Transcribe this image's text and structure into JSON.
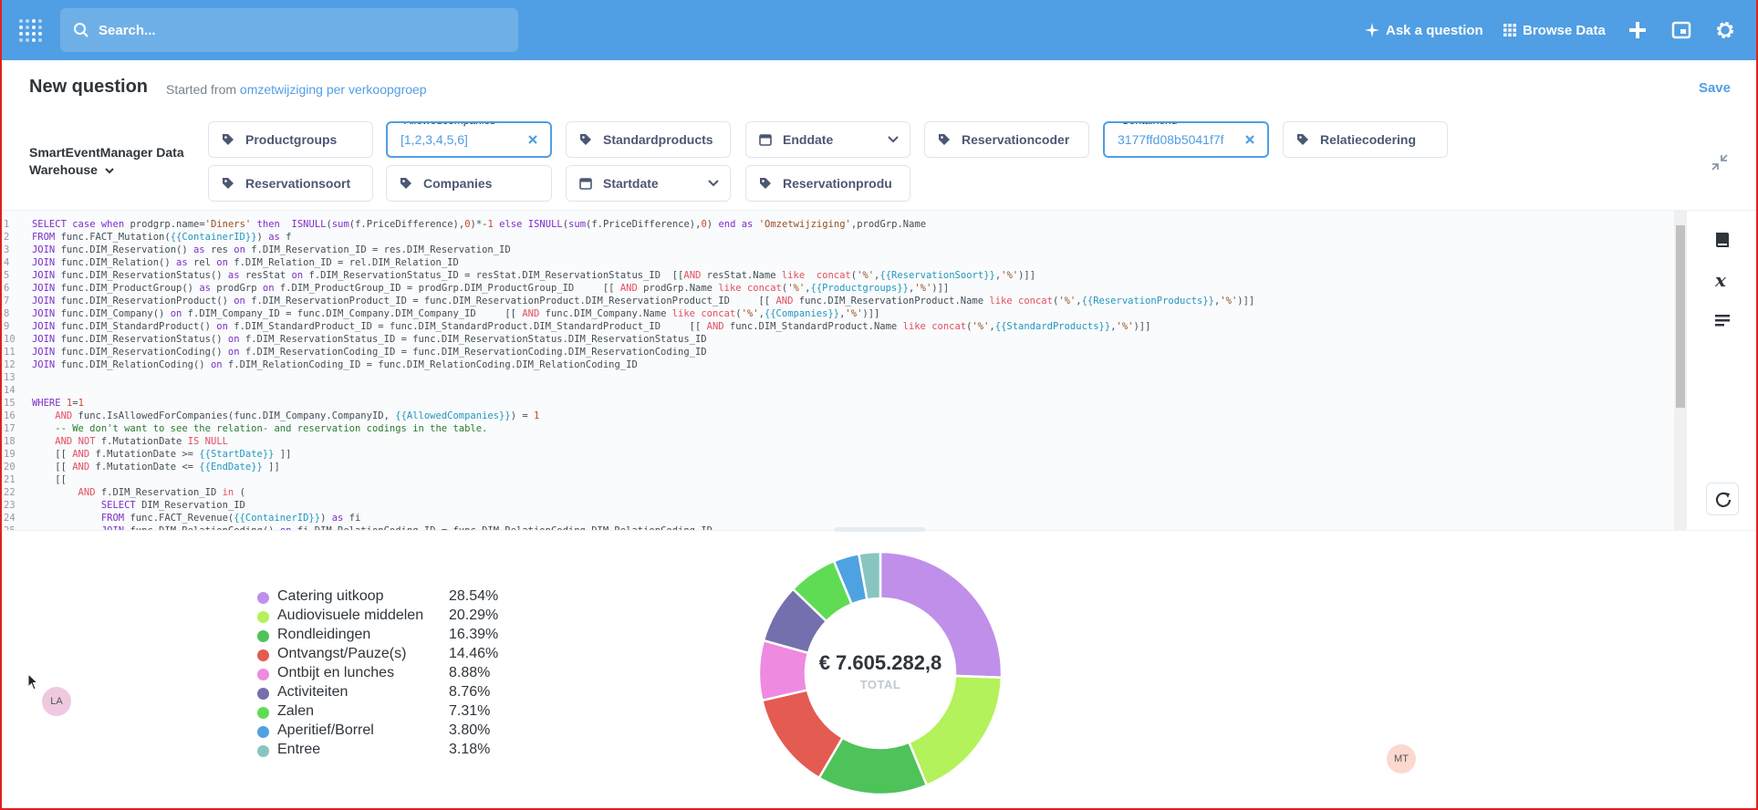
{
  "nav": {
    "search_placeholder": "Search...",
    "ask_label": "Ask a question",
    "browse_label": "Browse Data"
  },
  "header": {
    "title": "New question",
    "subtitle_prefix": "Started from",
    "subtitle_link": "omzetwijziging per verkoopgroep",
    "save_label": "Save"
  },
  "database": {
    "name": "SmartEventManager Data Warehouse"
  },
  "filters": [
    {
      "label": "Productgroups",
      "type": "tag"
    },
    {
      "label": "Allowedcompanies",
      "value": "[1,2,3,4,5,6]",
      "type": "tag",
      "active": true
    },
    {
      "label": "Standardproducts",
      "type": "tag"
    },
    {
      "label": "Enddate",
      "type": "date"
    },
    {
      "label": "Reservationcoder",
      "type": "tag"
    },
    {
      "label": "Containerid",
      "value": "3177ffd08b5041f7f",
      "type": "tag",
      "active": true
    },
    {
      "label": "Relatiecodering",
      "type": "tag"
    },
    {
      "label": "Reservationsoort",
      "type": "tag"
    },
    {
      "label": "Companies",
      "type": "tag"
    },
    {
      "label": "Startdate",
      "type": "date"
    },
    {
      "label": "Reservationprodu",
      "type": "tag"
    }
  ],
  "editor": {
    "lines": [
      "SELECT case when prodgrp.name='Diners' then  ISNULL(sum(f.PriceDifference),0)*-1 else ISNULL(sum(f.PriceDifference),0) end as 'Omzetwijziging',prodGrp.Name",
      "FROM func.FACT_Mutation({{ContainerID}}) as f",
      "JOIN func.DIM_Reservation() as res on f.DIM_Reservation_ID = res.DIM_Reservation_ID",
      "JOIN func.DIM_Relation() as rel on f.DIM_Relation_ID = rel.DIM_Relation_ID",
      "JOIN func.DIM_ReservationStatus() as resStat on f.DIM_ReservationStatus_ID = resStat.DIM_ReservationStatus_ID  [[AND resStat.Name like  concat('%',{{ReservationSoort}},'%')]]",
      "JOIN func.DIM_ProductGroup() as prodGrp on f.DIM_ProductGroup_ID = prodGrp.DIM_ProductGroup_ID     [[ AND prodGrp.Name like concat('%',{{Productgroups}},'%')]]",
      "JOIN func.DIM_ReservationProduct() on f.DIM_ReservationProduct_ID = func.DIM_ReservationProduct.DIM_ReservationProduct_ID     [[ AND func.DIM_ReservationProduct.Name like concat('%',{{ReservationProducts}},'%')]]",
      "JOIN func.DIM_Company() on f.DIM_Company_ID = func.DIM_Company.DIM_Company_ID     [[ AND func.DIM_Company.Name like concat('%',{{Companies}},'%')]]",
      "JOIN func.DIM_StandardProduct() on f.DIM_StandardProduct_ID = func.DIM_StandardProduct.DIM_StandardProduct_ID     [[ AND func.DIM_StandardProduct.Name like concat('%',{{StandardProducts}},'%')]]",
      "JOIN func.DIM_ReservationStatus() on f.DIM_ReservationStatus_ID = func.DIM_ReservationStatus.DIM_ReservationStatus_ID",
      "JOIN func.DIM_ReservationCoding() on f.DIM_ReservationCoding_ID = func.DIM_ReservationCoding.DIM_ReservationCoding_ID",
      "JOIN func.DIM_RelationCoding() on f.DIM_RelationCoding_ID = func.DIM_RelationCoding.DIM_RelationCoding_ID",
      "",
      "",
      "WHERE 1=1",
      "    AND func.IsAllowedForCompanies(func.DIM_Company.CompanyID, {{AllowedCompanies}}) = 1",
      "    -- We don't want to see the relation- and reservation codings in the table.",
      "    AND NOT f.MutationDate IS NULL",
      "    [[ AND f.MutationDate >= {{StartDate}} ]]",
      "    [[ AND f.MutationDate <= {{EndDate}} ]]",
      "    [[",
      "        AND f.DIM_Reservation_ID in (",
      "            SELECT DIM_Reservation_ID",
      "            FROM func.FACT_Revenue({{ContainerID}}) as fi",
      "            JOIN func.DIM_RelationCoding() on fi.DIM_RelationCoding_ID = func.DIM_RelationCoding.DIM_RelationCoding_ID"
    ]
  },
  "result": {
    "total_value": "€ 7.605.282,8",
    "total_label": "TOTAL"
  },
  "chart_data": {
    "type": "pie",
    "categories": [
      "Catering uitkoop",
      "Audiovisuele middelen",
      "Rondleidingen",
      "Ontvangst/Pauze(s)",
      "Ontbijt en lunches",
      "Activiteiten",
      "Zalen",
      "Aperitief/Borrel",
      "Entree"
    ],
    "values": [
      28.54,
      20.29,
      16.39,
      14.46,
      8.88,
      8.76,
      7.31,
      3.8,
      3.18
    ],
    "value_labels": [
      "28.54%",
      "20.29%",
      "16.39%",
      "14.46%",
      "8.88%",
      "8.76%",
      "7.31%",
      "3.80%",
      "3.18%"
    ],
    "colors": [
      "#c08fea",
      "#b3f25a",
      "#4ec35a",
      "#e45b52",
      "#ee8ae0",
      "#7470ad",
      "#5fdc54",
      "#4fa2e2",
      "#88c5c0"
    ],
    "legend_position": "left",
    "donut": true
  },
  "avatars": [
    "LA",
    "MT"
  ]
}
